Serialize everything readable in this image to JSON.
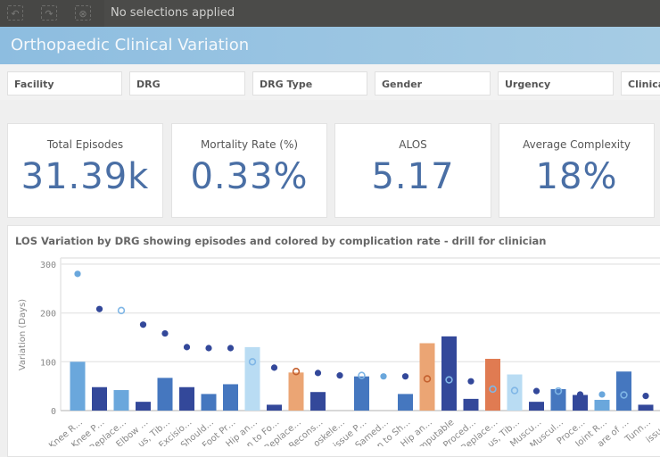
{
  "toolbar": {
    "selection_status": "No selections applied",
    "icons": [
      "step-back-icon",
      "step-forward-icon",
      "clear-selections-icon"
    ]
  },
  "app": {
    "title": "Orthopaedic Clinical Variation"
  },
  "filters": [
    "Facility",
    "DRG",
    "DRG Type",
    "Gender",
    "Urgency",
    "Clinical"
  ],
  "kpis": [
    {
      "label": "Total Episodes",
      "value": "31.39k"
    },
    {
      "label": "Mortality Rate (%)",
      "value": "0.33%"
    },
    {
      "label": "ALOS",
      "value": "5.17"
    },
    {
      "label": "Average Complexity",
      "value": "18%"
    }
  ],
  "colors": {
    "dark": "#33489a",
    "medium": "#4577bf",
    "light": "#6aa7dc",
    "pale": "#b9dcf3",
    "orange": "#eba574",
    "red_orange": "#e07b52",
    "accent_title": "#4a6fa5"
  },
  "chart_data": {
    "type": "bar",
    "title": "LOS Variation by DRG showing episodes and colored by complication rate - drill for clinician",
    "ylabel": "Variation (Days)",
    "xlabel": "",
    "ylim": [
      0,
      300
    ],
    "yticks": [
      "0",
      "100",
      "200",
      "300"
    ],
    "grid": true,
    "categories": [
      "Knee R…",
      "Knee P…",
      "Replace…",
      "Elbow …",
      "us, Tib…",
      "Excisio…",
      "Should…",
      "Foot Pr…",
      "Hip an…",
      "n to Fo…",
      "Replace…",
      "Recons…",
      "oskele…",
      "issue P…",
      "Samed…",
      "n to Sh…",
      "Hip an…",
      "mputable",
      "Proced…",
      "Replace…",
      "us, Tib…",
      "Muscu…",
      "Muscul…",
      "Proce…",
      "Joint R…",
      "are of …",
      "Tunn…",
      "issue P"
    ],
    "bars": [
      100,
      48,
      42,
      18,
      67,
      48,
      34,
      54,
      130,
      12,
      78,
      38,
      null,
      70,
      null,
      34,
      138,
      152,
      24,
      106,
      74,
      18,
      44,
      32,
      22,
      80,
      12,
      null
    ],
    "bar_colors": [
      "light",
      "dark",
      "light",
      "dark",
      "medium",
      "dark",
      "medium",
      "medium",
      "pale",
      "dark",
      "orange",
      "dark",
      null,
      "medium",
      null,
      "medium",
      "orange",
      "dark",
      "dark",
      "red_orange",
      "pale",
      "dark",
      "medium",
      "dark",
      "light",
      "medium",
      "dark",
      null
    ],
    "points": [
      280,
      208,
      205,
      176,
      158,
      130,
      128,
      128,
      100,
      88,
      80,
      77,
      72,
      72,
      70,
      70,
      65,
      63,
      60,
      44,
      41,
      40,
      40,
      33,
      33,
      32,
      30,
      null
    ],
    "point_styles": [
      "filled-light",
      "filled",
      "ring-light",
      "filled",
      "filled",
      "filled",
      "filled",
      "filled",
      "ring-light",
      "filled",
      "ring-orange",
      "filled",
      "filled",
      "ring-light",
      "filled-light",
      "filled",
      "ring-orange",
      "ring-light",
      "filled",
      "ring-light",
      "ring-light",
      "filled",
      "ring-light",
      "filled",
      "filled-light",
      "ring-light",
      "filled",
      null
    ]
  }
}
